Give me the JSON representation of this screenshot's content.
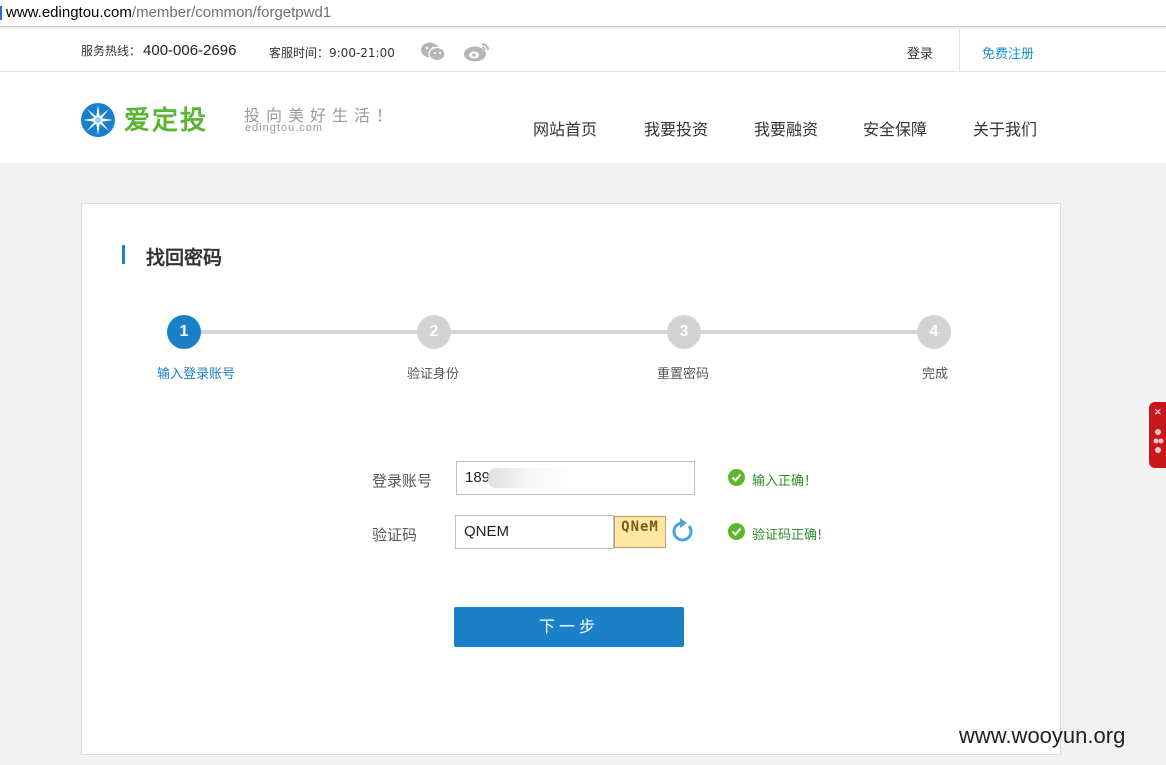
{
  "browser": {
    "url_host": "www.edingtou.com",
    "url_path": "/member/common/forgetpwd1"
  },
  "topbar": {
    "hotline_label": "服务热线：",
    "hotline_number": "400-006-2696",
    "hours": "客服时间：9:00-21:00",
    "login": "登录",
    "register": "免费注册",
    "icons": [
      "wechat-icon",
      "weibo-icon"
    ]
  },
  "header": {
    "brand": "爱定投",
    "slogan": "投向美好生活！",
    "domain": "edingtou.com",
    "nav": [
      "网站首页",
      "我要投资",
      "我要融资",
      "安全保障",
      "关于我们"
    ]
  },
  "card": {
    "title": "找回密码",
    "steps": [
      {
        "num": "1",
        "label": "输入登录账号",
        "active": true
      },
      {
        "num": "2",
        "label": "验证身份",
        "active": false
      },
      {
        "num": "3",
        "label": "重置密码",
        "active": false
      },
      {
        "num": "4",
        "label": "完成",
        "active": false
      }
    ],
    "form": {
      "account_label": "登录账号",
      "account_value": "189",
      "account_ok": "输入正确！",
      "captcha_label": "验证码",
      "captcha_value": "QNEM",
      "captcha_image_text": "QNeM",
      "captcha_ok": "验证码正确!"
    },
    "next_button": "下一步"
  },
  "colors": {
    "accent": "#1a80c8",
    "brand_green": "#5ab435",
    "success": "#5cb82a"
  },
  "watermark": "www.wooyun.org"
}
